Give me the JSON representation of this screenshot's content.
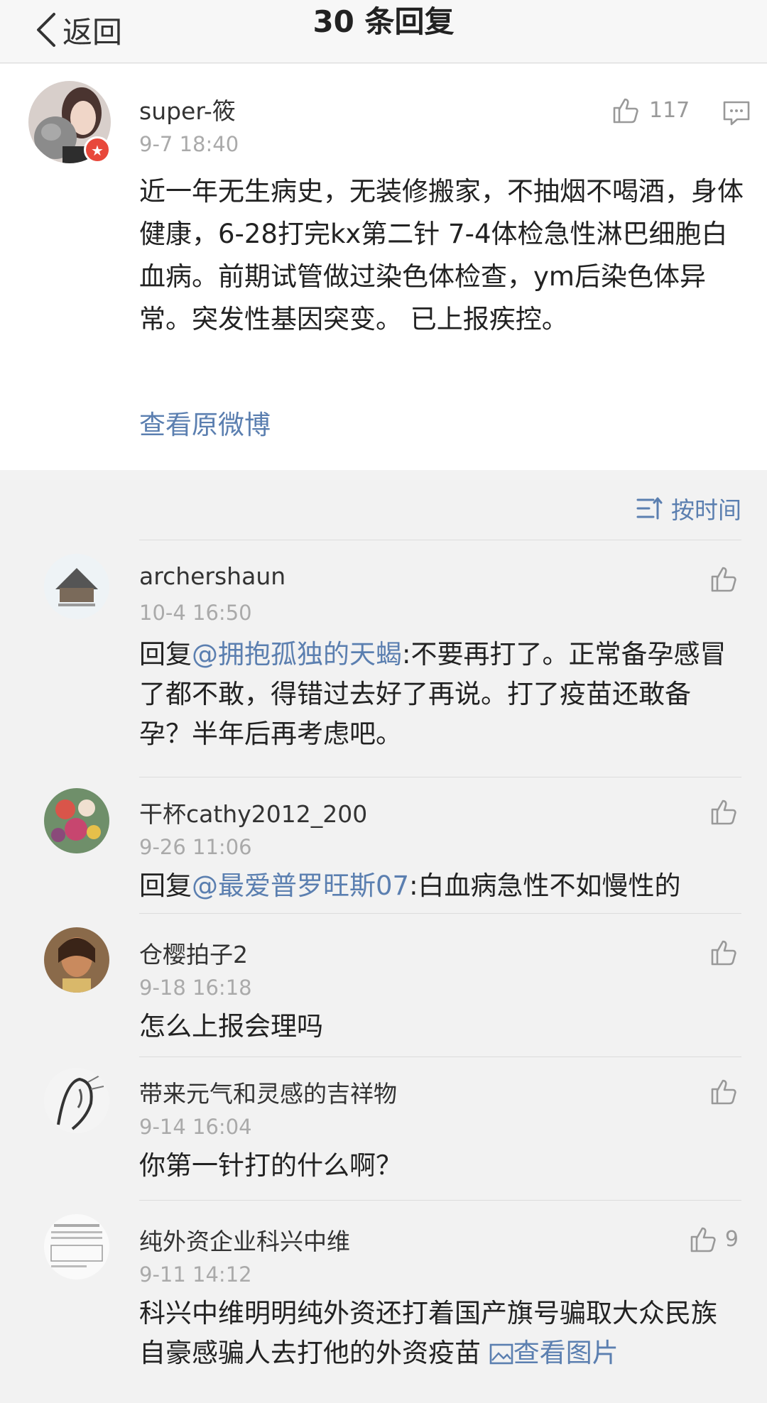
{
  "nav": {
    "back_label": "返回",
    "title": "30 条回复"
  },
  "main_comment": {
    "username": "super-筱",
    "time": "9-7 18:40",
    "likes": "117",
    "text": "近一年无生病史，无装修搬家，不抽烟不喝酒，身体健康，6-28打完kx第二针 7-4体检急性淋巴细胞白血病。前期试管做过染色体检查，ym后染色体异常。突发性基因突变。 已上报疾控。",
    "link": "查看原微博"
  },
  "sort": {
    "label": "按时间"
  },
  "replies": [
    {
      "username": "archershaun",
      "time": "10-4 16:50",
      "prefix": "回复",
      "mention": "@拥抱孤独的天蝎",
      "text": ":不要再打了。正常备孕感冒了都不敢，得错过去好了再说。打了疫苗还敢备孕？半年后再考虑吧。",
      "likes": ""
    },
    {
      "username": "干杯cathy2012_200",
      "time": "9-26 11:06",
      "prefix": "回复",
      "mention": "@最爱普罗旺斯07",
      "text": ":白血病急性不如慢性的",
      "likes": ""
    },
    {
      "username": "仓樱拍子2",
      "time": "9-18 16:18",
      "prefix": "",
      "mention": "",
      "text": "怎么上报会理吗",
      "likes": ""
    },
    {
      "username": "带来元气和灵感的吉祥物",
      "time": "9-14 16:04",
      "prefix": "",
      "mention": "",
      "text": "你第一针打的什么啊？",
      "likes": ""
    },
    {
      "username": "纯外资企业科兴中维",
      "time": "9-11 14:12",
      "prefix": "",
      "mention": "",
      "text": "科兴中维明明纯外资还打着国产旗号骗取大众民族自豪感骗人去打他的外资疫苗 ",
      "image_link": "查看图片",
      "likes": "9"
    }
  ],
  "colors": {
    "link": "#5b7fb0",
    "badge": "#e8483b"
  }
}
